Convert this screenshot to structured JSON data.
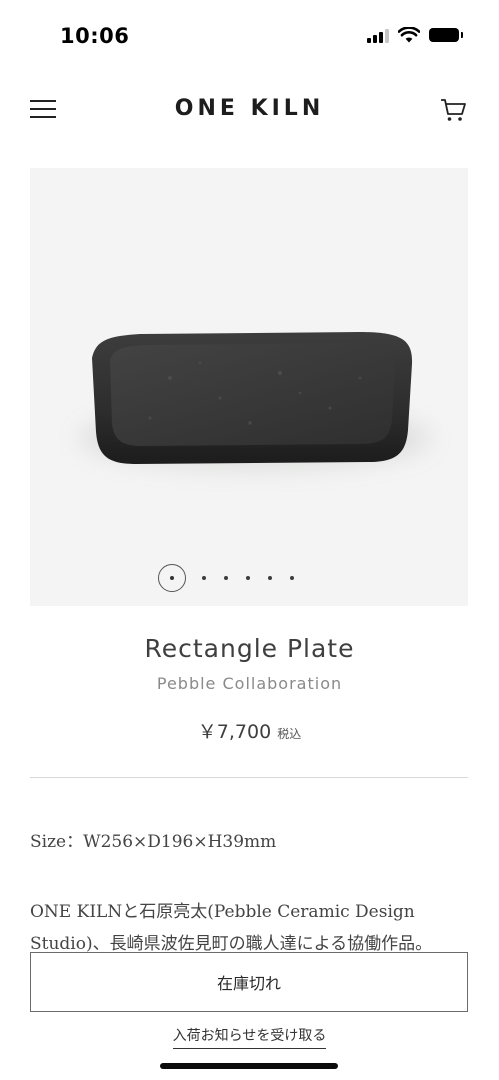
{
  "status": {
    "time": "10:06"
  },
  "header": {
    "logo": "ONE KILN",
    "menu_icon": "hamburger-menu-icon",
    "cart_icon": "shopping-cart-icon"
  },
  "gallery": {
    "total_images": 6,
    "current_image": 1
  },
  "product": {
    "title": "Rectangle Plate",
    "subtitle": "Pebble Collaboration",
    "price": "￥7,700",
    "tax_label": "税込",
    "size": "Size：W256×D196×H39mm",
    "description": "ONE KILNと石原亮太(Pebble Ceramic Design Studio)、長崎県波佐見町の職人達による協働作品。ONEKILNの定番であるASHの釉薬で仕上げました。"
  },
  "actions": {
    "out_of_stock_label": "在庫切れ",
    "notify_label": "入荷お知らせを受け取る"
  },
  "colors": {
    "text": "#3a3a3a",
    "muted": "#8a8a8a",
    "border": "#6b6b6b",
    "gallery_bg": "#f3f4f3"
  }
}
